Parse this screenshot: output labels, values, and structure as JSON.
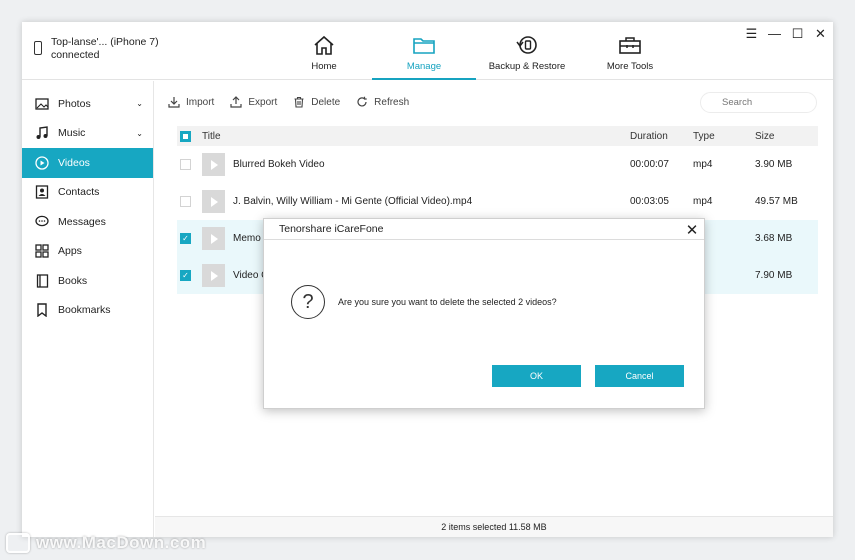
{
  "device": {
    "name": "Top-lanse'... (iPhone 7)",
    "status": "connected"
  },
  "nav": [
    {
      "label": "Home",
      "icon": "home-icon"
    },
    {
      "label": "Manage",
      "icon": "folder-icon",
      "active": true
    },
    {
      "label": "Backup & Restore",
      "icon": "backup-restore-icon"
    },
    {
      "label": "More Tools",
      "icon": "toolbox-icon"
    }
  ],
  "window_controls": {
    "menu": "☰",
    "minimize": "—",
    "maximize": "☐",
    "close": "✕"
  },
  "sidebar": [
    {
      "label": "Photos",
      "icon": "photo-icon",
      "chevron": "⌄"
    },
    {
      "label": "Music",
      "icon": "music-icon",
      "chevron": "⌄"
    },
    {
      "label": "Videos",
      "icon": "play-circle-icon",
      "active": true
    },
    {
      "label": "Contacts",
      "icon": "contacts-icon"
    },
    {
      "label": "Messages",
      "icon": "message-icon"
    },
    {
      "label": "Apps",
      "icon": "apps-icon"
    },
    {
      "label": "Books",
      "icon": "book-icon"
    },
    {
      "label": "Bookmarks",
      "icon": "bookmark-icon"
    }
  ],
  "toolbar": {
    "import": "Import",
    "export": "Export",
    "delete": "Delete",
    "refresh": "Refresh"
  },
  "search": {
    "placeholder": "Search"
  },
  "table": {
    "headers": {
      "title": "Title",
      "duration": "Duration",
      "type": "Type",
      "size": "Size"
    },
    "rows": [
      {
        "title": "Blurred Bokeh Video",
        "duration": "00:00:07",
        "type": "mp4",
        "size": "3.90 MB",
        "checked": false
      },
      {
        "title": "J. Balvin, Willy William - Mi Gente (Official Video).mp4",
        "duration": "00:03:05",
        "type": "mp4",
        "size": "49.57 MB",
        "checked": false
      },
      {
        "title": "Memo",
        "duration": "",
        "type": "p4",
        "size": "3.68 MB",
        "checked": true
      },
      {
        "title": "Video C",
        "duration": "",
        "type": "p4",
        "size": "7.90 MB",
        "checked": true
      }
    ]
  },
  "status": {
    "text": "2 items selected 11.58 MB"
  },
  "dialog": {
    "title": "Tenorshare iCareFone",
    "close": "✕",
    "icon_glyph": "?",
    "message": "Are you sure you want to delete the selected 2 videos?",
    "ok": "OK",
    "cancel": "Cancel"
  },
  "watermark": {
    "text": "www.MacDown.com"
  },
  "colors": {
    "accent": "#17a7c2",
    "selected_row": "#eaf8fb"
  }
}
